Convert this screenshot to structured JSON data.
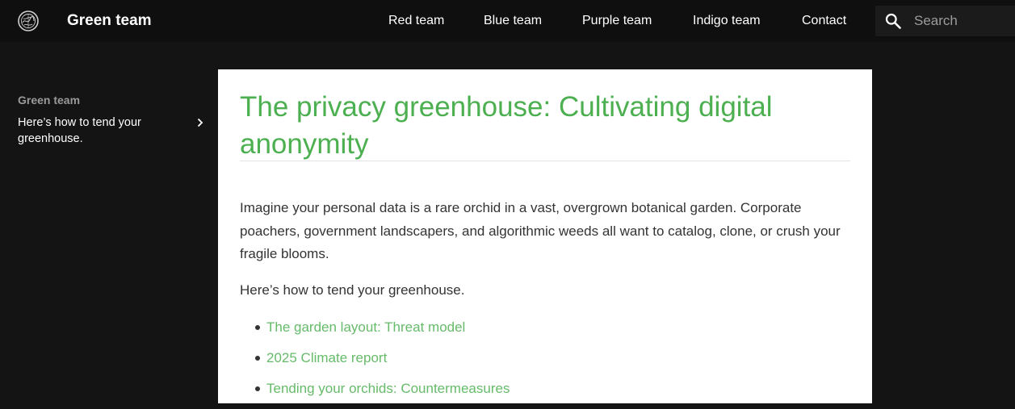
{
  "header": {
    "site_title": "Green team",
    "logo_icon": "circular-emblem-icon",
    "nav": [
      {
        "label": "Red team"
      },
      {
        "label": "Blue team"
      },
      {
        "label": "Purple team"
      },
      {
        "label": "Indigo team"
      },
      {
        "label": "Contact"
      }
    ],
    "search": {
      "placeholder": "Search",
      "value": "",
      "icon": "search-icon"
    }
  },
  "sidebar": {
    "section_title": "Green team",
    "items": [
      {
        "label": "Here’s how to tend your greenhouse.",
        "icon": "chevron-right-icon"
      }
    ]
  },
  "main": {
    "title": "The privacy greenhouse: Cultivating digital anonymity",
    "intro": "Imagine your personal data is a rare orchid in a vast, overgrown botanical garden. Corporate poachers, government landscapers, and algorithmic weeds all want to catalog, clone, or crush your fragile blooms.",
    "lead": "Here’s how to tend your greenhouse.",
    "links": [
      {
        "label": "The garden layout: Threat model"
      },
      {
        "label": "2025 Climate report"
      },
      {
        "label": "Tending your orchids: Countermeasures"
      }
    ]
  },
  "colors": {
    "header_background": "#0f0f0f",
    "page_background": "#141414",
    "accent_green": "#4caf50",
    "link_green": "#66bb6a",
    "content_background": "#ffffff",
    "body_text": "#333333"
  }
}
